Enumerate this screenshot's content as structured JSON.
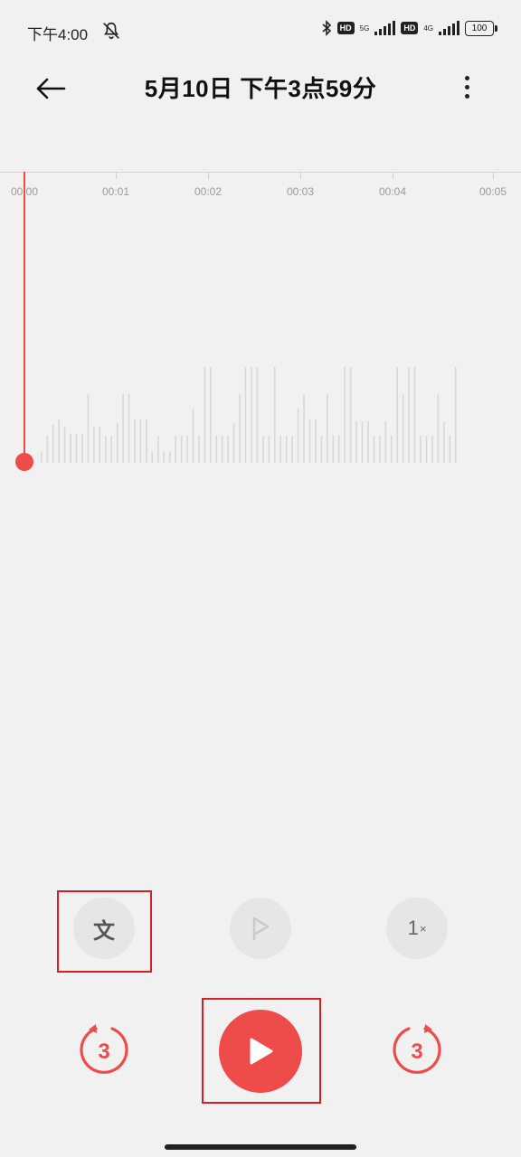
{
  "status_bar": {
    "time": "下午4:00",
    "hd_1": "HD",
    "net_1": "5G",
    "hd_2": "HD",
    "net_2": "4G",
    "battery": "100"
  },
  "header": {
    "title": "5月10日 下午3点59分"
  },
  "timeline": {
    "ticks": [
      "00:00",
      "00:01",
      "00:02",
      "00:03",
      "00:04",
      "00:05"
    ]
  },
  "controls": {
    "transcribe_label": "文",
    "speed_label": "1",
    "speed_suffix": "×",
    "skip_back_label": "3",
    "skip_forward_label": "3"
  },
  "colors": {
    "accent": "#ee4b4b",
    "background": "#f1f1f1",
    "waveform": "#d8d8d8"
  }
}
